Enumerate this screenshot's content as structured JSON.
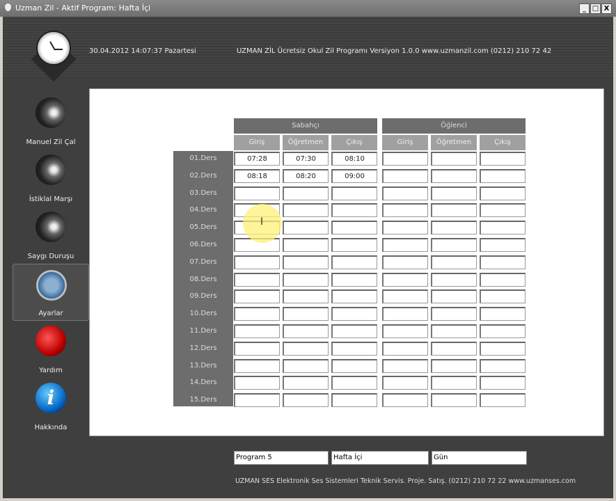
{
  "window": {
    "title": "Uzman Zil - Aktif Program: Hafta İçi",
    "buttons": [
      "_",
      "□",
      "X"
    ]
  },
  "header": {
    "datetime": "30.04.2012 14:07:37 Pazartesi",
    "info": "UZMAN ZİL  Ücretsiz Okul Zil Programı Versiyon 1.0.0 www.uzmanzil.com (0212) 210 72 42"
  },
  "sidebar": {
    "items": [
      {
        "label": "Manuel Zil Çal",
        "icon": "speaker-icon"
      },
      {
        "label": "İstiklal Marşı",
        "icon": "speaker-icon"
      },
      {
        "label": "Saygı Duruşu",
        "icon": "speaker-icon"
      },
      {
        "label": "Ayarlar",
        "icon": "compass-icon",
        "selected": true
      },
      {
        "label": "Yardım",
        "icon": "help-icon"
      },
      {
        "label": "Hakkında",
        "icon": "info-icon",
        "glyph": "i"
      }
    ]
  },
  "schedule": {
    "groups": [
      {
        "label": "Sabahçı"
      },
      {
        "label": "Öğlenci"
      }
    ],
    "columns": [
      "Giriş",
      "Öğretmen",
      "Çıkış"
    ],
    "rows": [
      {
        "label": "01.Ders",
        "values": [
          "07:28",
          "07:30",
          "08:10",
          "",
          "",
          ""
        ]
      },
      {
        "label": "02.Ders",
        "values": [
          "08:18",
          "08:20",
          "09:00",
          "",
          "",
          ""
        ]
      },
      {
        "label": "03.Ders",
        "values": [
          "",
          "",
          "",
          "",
          "",
          ""
        ]
      },
      {
        "label": "04.Ders",
        "values": [
          "",
          "",
          "",
          "",
          "",
          ""
        ]
      },
      {
        "label": "05.Ders",
        "values": [
          "",
          "",
          "",
          "",
          "",
          ""
        ]
      },
      {
        "label": "06.Ders",
        "values": [
          "",
          "",
          "",
          "",
          "",
          ""
        ]
      },
      {
        "label": "07.Ders",
        "values": [
          "",
          "",
          "",
          "",
          "",
          ""
        ]
      },
      {
        "label": "08.Ders",
        "values": [
          "",
          "",
          "",
          "",
          "",
          ""
        ]
      },
      {
        "label": "09.Ders",
        "values": [
          "",
          "",
          "",
          "",
          "",
          ""
        ]
      },
      {
        "label": "10.Ders",
        "values": [
          "",
          "",
          "",
          "",
          "",
          ""
        ]
      },
      {
        "label": "11.Ders",
        "values": [
          "",
          "",
          "",
          "",
          "",
          ""
        ]
      },
      {
        "label": "12.Ders",
        "values": [
          "",
          "",
          "",
          "",
          "",
          ""
        ]
      },
      {
        "label": "13.Ders",
        "values": [
          "",
          "",
          "",
          "",
          "",
          ""
        ]
      },
      {
        "label": "14.Ders",
        "values": [
          "",
          "",
          "",
          "",
          "",
          ""
        ]
      },
      {
        "label": "15.Ders",
        "values": [
          "",
          "",
          "",
          "",
          "",
          ""
        ]
      }
    ]
  },
  "footer": {
    "fields": [
      "Program 5",
      "Hafta İçi",
      "Gün"
    ],
    "text": "UZMAN SES  Elektronik Ses Sistemleri Teknik Servis. Proje. Satış. (0212) 210 72 22 www.uzmanses.com"
  }
}
